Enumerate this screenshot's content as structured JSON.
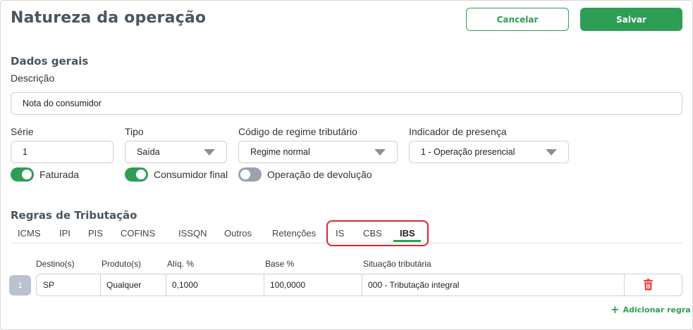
{
  "page": {
    "title": "Natureza da operação",
    "cancel_label": "Cancelar",
    "save_label": "Salvar"
  },
  "general": {
    "section_title": "Dados gerais",
    "description_label": "Descrição",
    "description_value": "Nota do consumidor",
    "series_label": "Série",
    "series_value": "1",
    "type_label": "Tipo",
    "type_value": "Saída",
    "regime_label": "Código de regime tributário",
    "regime_value": "Regime normal",
    "presence_label": "Indicador de presença",
    "presence_value": "1 - Operação presencial"
  },
  "toggles": [
    {
      "label": "Faturada",
      "on": true
    },
    {
      "label": "Consumidor final",
      "on": true
    },
    {
      "label": "Operação de devolução",
      "on": false
    }
  ],
  "taxation": {
    "section_title": "Regras de Tributação",
    "tabs": [
      "ICMS",
      "IPI",
      "PIS",
      "COFINS",
      "ISSQN",
      "Outros",
      "Retenções",
      "IS",
      "CBS",
      "IBS"
    ],
    "active_tab": "IBS",
    "columns": [
      "Destino(s)",
      "Produto(s)",
      "Alíq. %",
      "Base %",
      "Situação tributária"
    ],
    "rows": [
      {
        "index": "1",
        "destination": "SP",
        "product": "Qualquer",
        "rate": "0,1000",
        "base": "100,0000",
        "situation": "000 - Tributação integral"
      }
    ],
    "add_rule_label": "Adicionar regra"
  },
  "colors": {
    "accent": "#2e9e55",
    "highlight": "#e0232f",
    "delete": "#e53935"
  }
}
